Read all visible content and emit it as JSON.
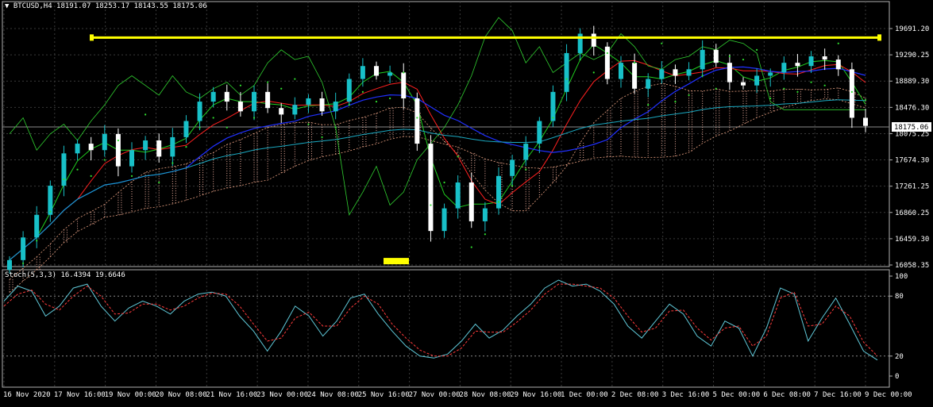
{
  "header": {
    "symbol": "BTCUSD,H4",
    "open": "18191.07",
    "high": "18253.17",
    "low": "18143.55",
    "close": "18175.06"
  },
  "stoch_header": {
    "label": "Stoch(5,3,3)",
    "main": "16.4394",
    "signal": "19.6646"
  },
  "chart_data": [
    {
      "type": "candlestick",
      "title": "BTCUSD,H4",
      "ylim": [
        16000,
        19900
      ],
      "yticks": [
        "19691.20",
        "19290.25",
        "18889.30",
        "18476.30",
        "18075.25",
        "17674.30",
        "17261.25",
        "16860.25",
        "16459.30",
        "16058.35"
      ],
      "current_price": "18175.06",
      "xticks": [
        "16 Nov 2020",
        "17 Nov 16:00",
        "19 Nov 00:00",
        "20 Nov 08:00",
        "21 Nov 16:00",
        "23 Nov 00:00",
        "24 Nov 08:00",
        "25 Nov 16:00",
        "27 Nov 00:00",
        "28 Nov 08:00",
        "29 Nov 16:00",
        "1 Dec 00:00",
        "2 Dec 08:00",
        "3 Dec 16:00",
        "5 Dec 00:00",
        "6 Dec 08:00",
        "7 Dec 16:00",
        "9 Dec 00:00"
      ],
      "close_path": [
        16100,
        16450,
        16800,
        17250,
        17750,
        17900,
        17800,
        18050,
        17550,
        17800,
        17950,
        17700,
        18000,
        18250,
        18550,
        18700,
        18550,
        18400,
        18700,
        18450,
        18350,
        18500,
        18600,
        18400,
        18550,
        18900,
        19100,
        18950,
        19000,
        18600,
        17900,
        16550,
        16900,
        17300,
        16700,
        16900,
        17400,
        17650,
        17900,
        18250,
        18700,
        19300,
        19600,
        19400,
        18900,
        19150,
        18750,
        18900,
        19050,
        18950,
        19050,
        19350,
        19150,
        18850,
        18800,
        18950,
        19000,
        19150,
        19100,
        19250,
        19200,
        19050,
        18300,
        18175
      ],
      "resistance_level": 19540,
      "support_marker": 16060,
      "grid": true
    },
    {
      "type": "line",
      "title": "Stoch(5,3,3)",
      "ylim": [
        0,
        100
      ],
      "yticks": [
        "100",
        "80",
        "20",
        "0"
      ],
      "series": [
        {
          "name": "Main",
          "color": "#5fc8d8",
          "values": [
            75,
            90,
            85,
            60,
            70,
            88,
            92,
            70,
            55,
            68,
            75,
            70,
            62,
            75,
            82,
            84,
            80,
            60,
            45,
            25,
            45,
            70,
            60,
            40,
            55,
            78,
            82,
            62,
            45,
            30,
            20,
            18,
            22,
            35,
            52,
            38,
            46,
            60,
            72,
            88,
            96,
            90,
            92,
            85,
            72,
            50,
            38,
            55,
            72,
            62,
            40,
            30,
            55,
            48,
            20,
            48,
            88,
            82,
            35,
            58,
            78,
            52,
            25,
            16
          ]
        },
        {
          "name": "Signal",
          "color": "#ff3b3b",
          "values": [
            70,
            82,
            86,
            72,
            66,
            80,
            90,
            80,
            62,
            63,
            72,
            72,
            66,
            70,
            78,
            83,
            82,
            70,
            52,
            35,
            38,
            58,
            64,
            50,
            50,
            68,
            80,
            72,
            52,
            38,
            26,
            20,
            20,
            28,
            45,
            44,
            44,
            54,
            66,
            82,
            92,
            92,
            90,
            88,
            78,
            60,
            44,
            48,
            65,
            66,
            48,
            36,
            48,
            50,
            30,
            40,
            78,
            84,
            50,
            52,
            70,
            60,
            34,
            20
          ]
        }
      ]
    }
  ]
}
